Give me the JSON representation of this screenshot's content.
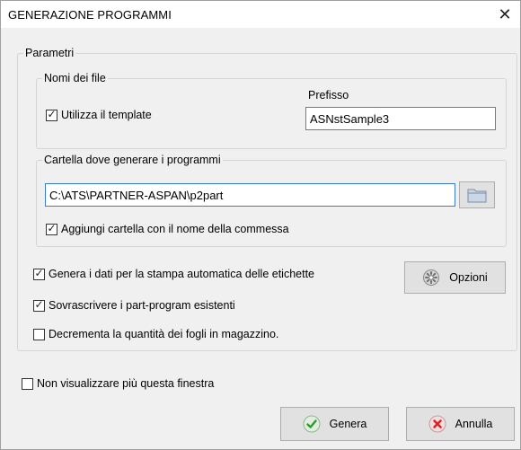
{
  "window": {
    "title": "GENERAZIONE PROGRAMMI",
    "close_glyph": "✕"
  },
  "parametri": {
    "legend": "Parametri",
    "nomi_file": {
      "legend": "Nomi dei file",
      "use_template_label": "Utilizza il template",
      "use_template_checked": true,
      "prefisso_label": "Prefisso",
      "prefisso_value": "ASNstSample3"
    },
    "cartella": {
      "legend": "Cartella dove generare i programmi",
      "path_value": "C:\\ATS\\PARTNER-ASPAN\\p2part",
      "browse_icon": "folder-icon",
      "add_folder_label": "Aggiungi cartella con il nome della commessa",
      "add_folder_checked": true
    },
    "options": [
      {
        "label": "Genera i dati per la stampa automatica delle etichette",
        "checked": true
      },
      {
        "label": "Sovrascrivere i part-program esistenti",
        "checked": true
      },
      {
        "label": "Decrementa la quantità dei fogli in magazzino.",
        "checked": false
      }
    ],
    "opzioni_button": {
      "label": "Opzioni",
      "icon": "gear-icon"
    }
  },
  "footer": {
    "dont_show_label": "Non visualizzare più questa finestra",
    "dont_show_checked": false,
    "genera_button": {
      "label": "Genera",
      "icon": "check-icon"
    },
    "annulla_button": {
      "label": "Annulla",
      "icon": "cancel-icon"
    }
  },
  "colors": {
    "dialog_bg": "#f0f0f0",
    "check_green": "#2e9a2e",
    "cancel_red": "#d8232a",
    "focus_border": "#3a7bd5"
  },
  "checkmark_glyph": "✓"
}
